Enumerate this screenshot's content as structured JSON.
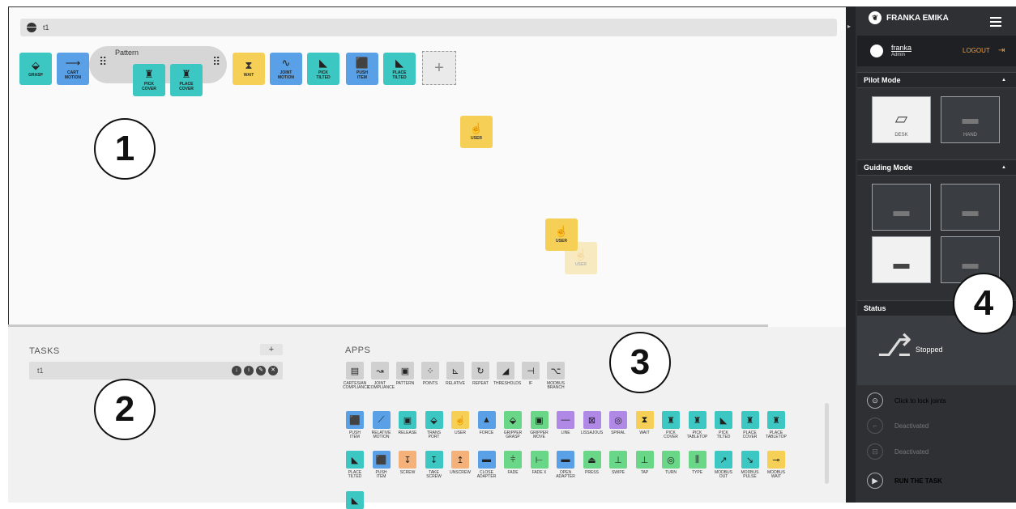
{
  "task_bar": {
    "name": "t1"
  },
  "timeline": {
    "tiles": [
      {
        "label": "GRASP",
        "icon": "⬙",
        "color": "teal"
      },
      {
        "label": "CART\nMOTION",
        "icon": "⟶",
        "color": "blue"
      },
      {
        "label": "WAIT",
        "icon": "⧗",
        "color": "yellow"
      },
      {
        "label": "JOINT\nMOTION",
        "icon": "∿",
        "color": "blue"
      },
      {
        "label": "PICK\nTILTED",
        "icon": "◣",
        "color": "teal"
      },
      {
        "label": "PUSH\nITEM",
        "icon": "⬛",
        "color": "blue"
      },
      {
        "label": "PLACE\nTILTED",
        "icon": "◣",
        "color": "teal"
      }
    ],
    "pattern": {
      "title": "Pattern",
      "children": [
        {
          "label": "PICK\nCOVER",
          "icon": "♜"
        },
        {
          "label": "PLACE\nCOVER",
          "icon": "♜"
        }
      ]
    },
    "add_label": "+",
    "floating": [
      {
        "label": "USER"
      },
      {
        "label": "USER"
      },
      {
        "label": "USER"
      }
    ]
  },
  "badges": [
    "1",
    "2",
    "3",
    "4"
  ],
  "tasks": {
    "title": "TASKS",
    "add_label": "+",
    "rows": [
      {
        "name": "t1"
      }
    ]
  },
  "apps": {
    "title": "APPS",
    "row1": [
      {
        "label": "CARTESIAN\nCOMPLIANCE",
        "icon": "▤"
      },
      {
        "label": "JOINT\nCOMPLIANCE",
        "icon": "↝"
      },
      {
        "label": "PATTERN",
        "icon": "▣"
      },
      {
        "label": "POINTS",
        "icon": "⁘"
      },
      {
        "label": "RELATIVE",
        "icon": "⊾"
      },
      {
        "label": "REPEAT",
        "icon": "↻"
      },
      {
        "label": "THRESHOLDS",
        "icon": "◢"
      },
      {
        "label": "IF",
        "icon": "⊣"
      },
      {
        "label": "MODBUS\nBRANCH",
        "icon": "⌥"
      }
    ],
    "row2": [
      {
        "label": "PUSH\nITEM",
        "icon": "⬛",
        "c": "c-blue"
      },
      {
        "label": "RELATIVE\nMOTION",
        "icon": "⟋",
        "c": "c-blue"
      },
      {
        "label": "RELEASE",
        "icon": "▣",
        "c": "c-teal"
      },
      {
        "label": "TRANS\nPORT",
        "icon": "⬙",
        "c": "c-teal"
      },
      {
        "label": "USER",
        "icon": "☝",
        "c": "c-yellow"
      },
      {
        "label": "FORCE",
        "icon": "▲",
        "c": "c-blue"
      },
      {
        "label": "GRIPPER\nGRASP",
        "icon": "⬙",
        "c": "c-green"
      },
      {
        "label": "GRIPPER\nMOVE",
        "icon": "▣",
        "c": "c-green"
      },
      {
        "label": "LINE",
        "icon": "—",
        "c": "c-purple"
      },
      {
        "label": "LISSAJOUS",
        "icon": "⊠",
        "c": "c-purple"
      },
      {
        "label": "SPIRAL",
        "icon": "◎",
        "c": "c-purple"
      },
      {
        "label": "WAIT",
        "icon": "⧗",
        "c": "c-yellow"
      },
      {
        "label": "PICK\nCOVER",
        "icon": "♜",
        "c": "c-teal"
      },
      {
        "label": "PICK\nTABLETOP",
        "icon": "♜",
        "c": "c-teal"
      },
      {
        "label": "PICK\nTILTED",
        "icon": "◣",
        "c": "c-teal"
      },
      {
        "label": "PLACE\nCOVER",
        "icon": "♜",
        "c": "c-teal"
      },
      {
        "label": "PLACE\nTABLETOP",
        "icon": "♜",
        "c": "c-teal"
      }
    ],
    "row3": [
      {
        "label": "PLACE\nTILTED",
        "icon": "◣",
        "c": "c-teal"
      },
      {
        "label": "PUSH\nITEM",
        "icon": "⬛",
        "c": "c-blue"
      },
      {
        "label": "SCREW",
        "icon": "↧",
        "c": "c-orange"
      },
      {
        "label": "TAKE\nSCREW",
        "icon": "↧",
        "c": "c-teal"
      },
      {
        "label": "UNSCREW",
        "icon": "↥",
        "c": "c-orange"
      },
      {
        "label": "CLOSE\nADAPTER",
        "icon": "▬",
        "c": "c-blue"
      },
      {
        "label": "FADE",
        "icon": "⫩",
        "c": "c-green"
      },
      {
        "label": "FADE X",
        "icon": "⊢",
        "c": "c-green"
      },
      {
        "label": "OPEN\nADAPTER",
        "icon": "▬",
        "c": "c-blue"
      },
      {
        "label": "PRESS",
        "icon": "⏏",
        "c": "c-green"
      },
      {
        "label": "SWIPE",
        "icon": "⊥",
        "c": "c-green"
      },
      {
        "label": "TAP",
        "icon": "⊥",
        "c": "c-green"
      },
      {
        "label": "TURN",
        "icon": "◎",
        "c": "c-green"
      },
      {
        "label": "TYPE",
        "icon": "⫼",
        "c": "c-green"
      },
      {
        "label": "MODBUS\nOUT",
        "icon": "↗",
        "c": "c-teal"
      },
      {
        "label": "MODBUS\nPULSE",
        "icon": "↘",
        "c": "c-teal"
      },
      {
        "label": "MODBUS\nWAIT",
        "icon": "⊸",
        "c": "c-yellow"
      }
    ]
  },
  "sidebar": {
    "brand": "FRANKA EMIKA",
    "user": {
      "name": "franka",
      "role": "Admin"
    },
    "logout_label": "LOGOUT",
    "pilot_title": "Pilot Mode",
    "pilot_modes": [
      {
        "label": "DESK",
        "icon": "▱"
      },
      {
        "label": "HAND",
        "icon": "▬"
      }
    ],
    "guiding_title": "Guiding Mode",
    "status_title": "Status",
    "status_value": "Stopped",
    "actions": [
      {
        "label": "Click to lock joints",
        "icon": "⊙"
      },
      {
        "label": "Deactivated",
        "icon": "⌐"
      },
      {
        "label": "Deactivated",
        "icon": "⊟"
      },
      {
        "label": "RUN THE TASK",
        "icon": "▶"
      }
    ]
  }
}
